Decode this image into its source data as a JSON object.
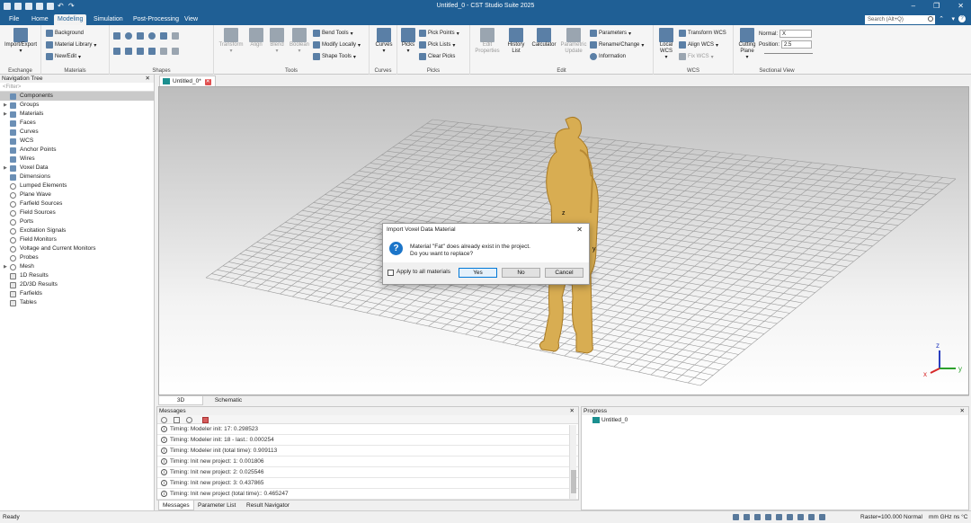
{
  "window": {
    "title": "Untitled_0 - CST Studio Suite 2025"
  },
  "menu": {
    "tabs": [
      "File",
      "Home",
      "Modeling",
      "Simulation",
      "Post-Processing",
      "View"
    ],
    "active": "Modeling",
    "search_placeholder": "Search (Alt+Q)"
  },
  "ribbon": {
    "exchange": {
      "label": "Exchange",
      "import_export": "Import/Export"
    },
    "materials": {
      "label": "Materials",
      "background": "Background",
      "material_library": "Material Library",
      "new_edit": "New/Edit"
    },
    "shapes": {
      "label": "Shapes"
    },
    "tools": {
      "label": "Tools",
      "transform": "Transform",
      "align": "Align",
      "blend": "Blend",
      "boolean": "Boolean",
      "bend_tools": "Bend Tools",
      "modify_locally": "Modify Locally",
      "shape_tools": "Shape Tools"
    },
    "curves": {
      "label": "Curves",
      "curves": "Curves"
    },
    "picks": {
      "label": "Picks",
      "picks": "Picks",
      "pick_points": "Pick Points",
      "pick_lists": "Pick Lists",
      "clear_picks": "Clear Picks"
    },
    "edit": {
      "label": "Edit",
      "edit_properties": "Edit Properties",
      "history_list": "History List",
      "calculator": "Calculator",
      "parametric_update": "Parametric Update",
      "parameters": "Parameters",
      "rename_change": "Rename/Change",
      "information": "Information"
    },
    "wcs": {
      "label": "WCS",
      "local_wcs": "Local WCS",
      "transform_wcs": "Transform WCS",
      "align_wcs": "Align WCS",
      "fix_wcs": "Fix WCS"
    },
    "sectional": {
      "label": "Sectional View",
      "cutting_plane": "Cutting Plane",
      "normal_label": "Normal:",
      "normal_value": "X",
      "position_label": "Position:",
      "position_value": "2.5"
    }
  },
  "navtree": {
    "title": "Navigation Tree",
    "filter_placeholder": "<Filter>",
    "items": [
      {
        "label": "Components",
        "selected": true,
        "expandable": false
      },
      {
        "label": "Groups",
        "expandable": true
      },
      {
        "label": "Materials",
        "expandable": true
      },
      {
        "label": "Faces"
      },
      {
        "label": "Curves"
      },
      {
        "label": "WCS"
      },
      {
        "label": "Anchor Points"
      },
      {
        "label": "Wires"
      },
      {
        "label": "Voxel Data",
        "expandable": true
      },
      {
        "label": "Dimensions"
      },
      {
        "label": "Lumped Elements"
      },
      {
        "label": "Plane Wave"
      },
      {
        "label": "Farfield Sources"
      },
      {
        "label": "Field Sources"
      },
      {
        "label": "Ports"
      },
      {
        "label": "Excitation Signals"
      },
      {
        "label": "Field Monitors"
      },
      {
        "label": "Voltage and Current Monitors"
      },
      {
        "label": "Probes"
      },
      {
        "label": "Mesh",
        "expandable": true
      },
      {
        "label": "1D Results"
      },
      {
        "label": "2D/3D Results"
      },
      {
        "label": "Farfields"
      },
      {
        "label": "Tables"
      }
    ]
  },
  "document": {
    "tab_label": "Untitled_0*",
    "view_tabs": [
      "3D",
      "Schematic"
    ]
  },
  "axes": {
    "x": "x",
    "y": "y",
    "z": "z"
  },
  "dialog": {
    "title": "Import Voxel Data Material",
    "message_line1": "Material \"Fat\" does already exist in the project.",
    "message_line2": "Do you want to replace?",
    "checkbox_label": "Apply to all materials",
    "yes": "Yes",
    "no": "No",
    "cancel": "Cancel"
  },
  "messages": {
    "title": "Messages",
    "lines": [
      "Timing: Modeler init: 17: 0.298523",
      "Timing: Modeler init: 18 - last.: 0.000254",
      "Timing: Modeler init (total time): 0.909113",
      "Timing: Init new project: 1: 0.001806",
      "Timing: Init new project: 2: 0.025546",
      "Timing: Init new project: 3: 0.437865",
      "Timing: Init new project (total time):: 0.465247"
    ],
    "tabs": [
      "Messages",
      "Parameter List",
      "Result Navigator"
    ]
  },
  "progress": {
    "title": "Progress",
    "item": "Untitled_0"
  },
  "statusbar": {
    "status": "Ready",
    "raster": "Raster=100.000",
    "mode": "Normal",
    "units": "mm  GHz  ns  °C"
  }
}
